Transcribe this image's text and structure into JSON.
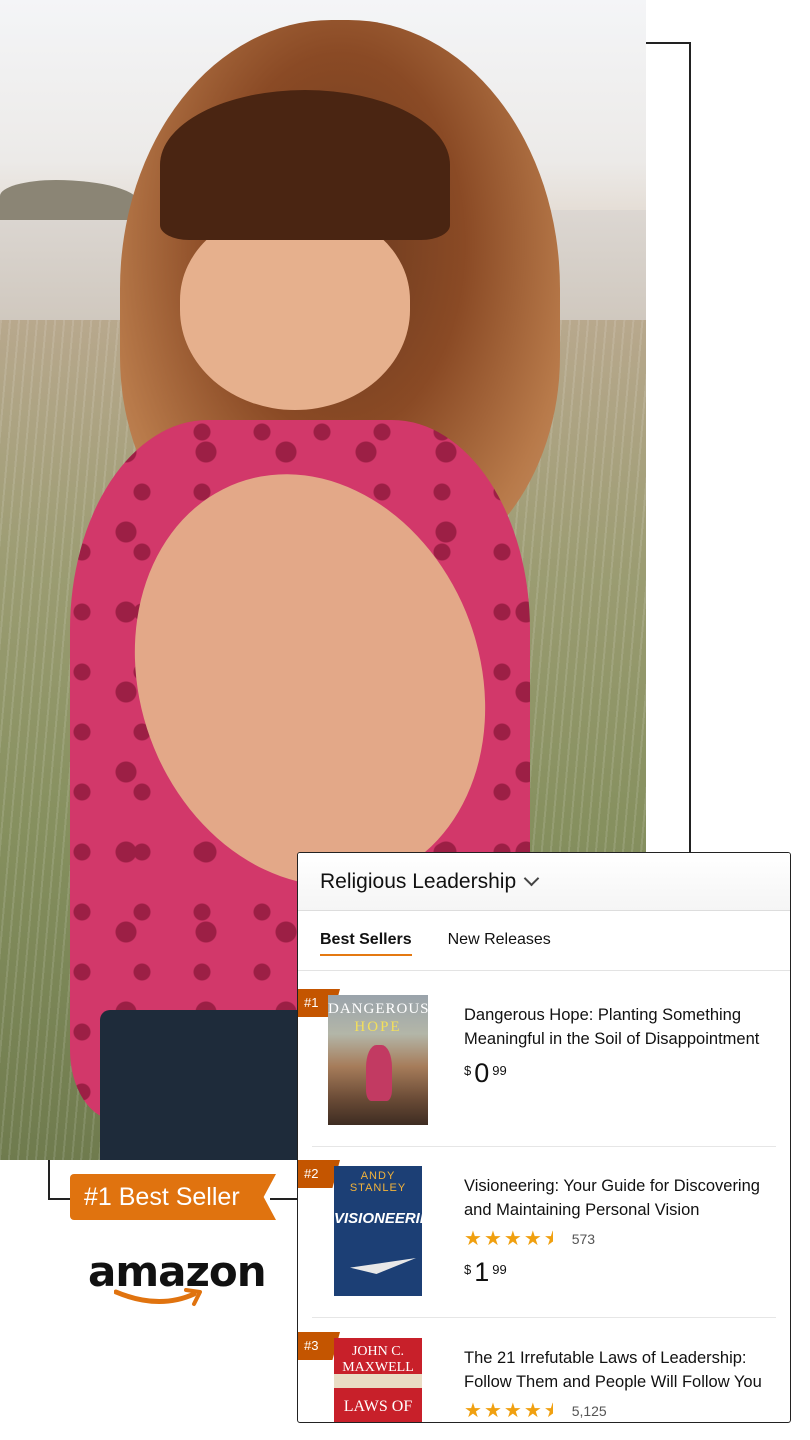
{
  "badge": {
    "label": "#1 Best Seller"
  },
  "brand": {
    "logo_text": "amazon",
    "accent_color": "#e0730f"
  },
  "panel": {
    "category": "Religious Leadership",
    "tabs": [
      {
        "label": "Best Sellers",
        "active": true
      },
      {
        "label": "New Releases",
        "active": false
      }
    ],
    "items": [
      {
        "rank": "#1",
        "title": "Dangerous Hope: Planting Something Meaningful in the Soil of Disappointment",
        "cover_title_1": "DANGEROUS",
        "cover_title_2": "HOPE",
        "price_symbol": "$",
        "price_whole": "0",
        "price_cents": "99"
      },
      {
        "rank": "#2",
        "title": "Visioneering: Your Guide for Discovering and Maintaining Personal Vision",
        "cover_author_1": "ANDY",
        "cover_author_2": "STANLEY",
        "cover_title": "VISIONEERING",
        "rating": 4.5,
        "rating_count": "573",
        "price_symbol": "$",
        "price_whole": "1",
        "price_cents": "99"
      },
      {
        "rank": "#3",
        "title": "The 21 Irrefutable Laws of Leadership: Follow Them and People Will Follow You",
        "cover_author": "JOHN C. MAXWELL",
        "cover_title": "LAWS OF",
        "rating": 4.5,
        "rating_count": "5,125"
      }
    ]
  }
}
